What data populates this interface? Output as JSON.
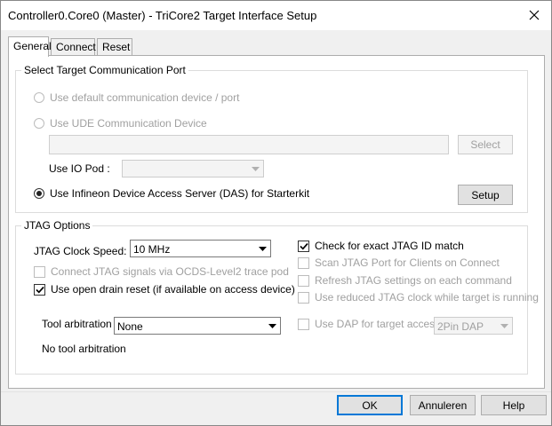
{
  "window": {
    "title": "Controller0.Core0 (Master) - TriCore2 Target Interface Setup"
  },
  "tabs": [
    {
      "label": "General",
      "active": true
    },
    {
      "label": "Connect",
      "active": false
    },
    {
      "label": "Reset",
      "active": false
    }
  ],
  "port_group": {
    "title": "Select Target Communication Port",
    "radio_default": "Use default communication device / port",
    "radio_ude": "Use UDE Communication Device",
    "device_value": "",
    "select_label": "Select",
    "io_pod_label": "Use IO Pod :",
    "io_pod_value": "",
    "radio_das": "Use Infineon Device Access Server (DAS) for Starterkit",
    "setup_label": "Setup"
  },
  "jtag_group": {
    "title": "JTAG Options",
    "clock_label": "JTAG Clock Speed:",
    "clock_value": "10 MHz",
    "connect_ocds": "Connect JTAG signals via OCDS-Level2 trace pod",
    "open_drain": "Use open drain reset (if available on access device)",
    "tool_arb_label": "Tool arbitration :",
    "tool_arb_value": "None",
    "tool_arb_status": "No tool arbitration",
    "check_id": "Check for exact JTAG ID match",
    "scan_port": "Scan JTAG Port for Clients on Connect",
    "refresh": "Refresh JTAG settings on each command",
    "reduced_clock": "Use reduced JTAG clock while target is running",
    "use_dap": "Use DAP for target access",
    "dap_value": "2Pin DAP"
  },
  "footer": {
    "ok": "OK",
    "cancel": "Annuleren",
    "help": "Help"
  },
  "colors": {
    "default_button_border": "#0078d7",
    "disabled_text": "#a0a0a0"
  }
}
